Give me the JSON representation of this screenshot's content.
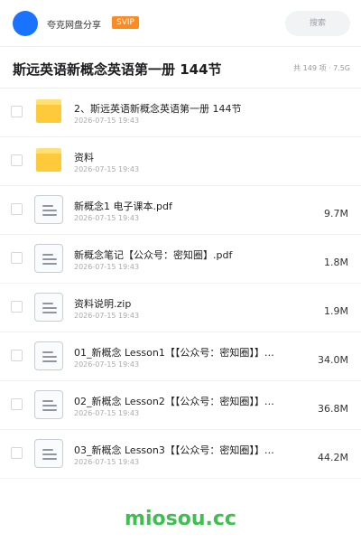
{
  "header": {
    "site_name": "夸克网盘分享",
    "badge": "SVIP",
    "search_placeholder": "搜索",
    "avatar_color": "#1a73ff",
    "badge_color": "#ff8a1f"
  },
  "folder": {
    "title": "斯远英语新概念英语第一册 144节",
    "summary": "共 149 项 · 7.5G"
  },
  "items": [
    {
      "type": "folder",
      "icon": "folder-icon",
      "name": "2、斯远英语新概念英语第一册  144节",
      "date": "2026-07-15 19:43",
      "size": ""
    },
    {
      "type": "folder",
      "icon": "folder-icon",
      "name": "资料",
      "date": "2026-07-15 19:43",
      "size": ""
    },
    {
      "type": "file",
      "icon": "document-icon",
      "name": "新概念1 电子课本.pdf",
      "date": "2026-07-15 19:43",
      "size": "9.7M"
    },
    {
      "type": "file",
      "icon": "document-icon",
      "name": "新概念笔记【公众号：密知圈】.pdf",
      "date": "2026-07-15 19:43",
      "size": "1.8M"
    },
    {
      "type": "file",
      "icon": "document-icon",
      "name": "资料说明.zip",
      "date": "2026-07-15 19:43",
      "size": "1.9M"
    },
    {
      "type": "file",
      "icon": "document-icon",
      "name": "01_新概念 Lesson1【【公众号：密知圈】】…",
      "date": "2026-07-15 19:43",
      "size": "34.0M"
    },
    {
      "type": "file",
      "icon": "document-icon",
      "name": "02_新概念 Lesson2【【公众号：密知圈】】…",
      "date": "2026-07-15 19:43",
      "size": "36.8M"
    },
    {
      "type": "file",
      "icon": "document-icon",
      "name": "03_新概念 Lesson3【【公众号：密知圈】】…",
      "date": "2026-07-15 19:43",
      "size": "44.2M"
    }
  ],
  "watermark": "miosou.cc"
}
